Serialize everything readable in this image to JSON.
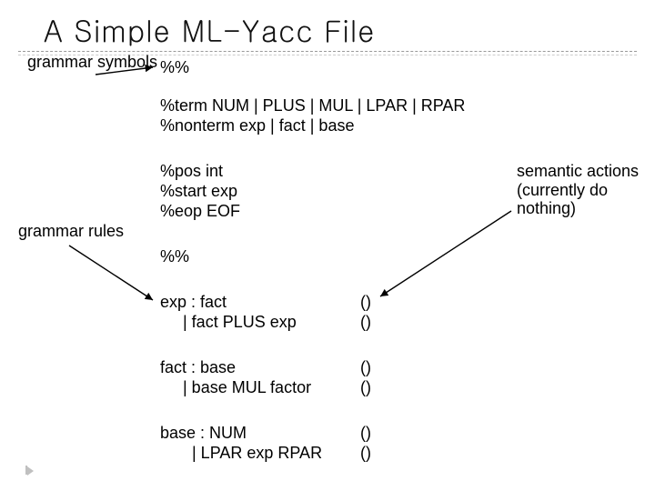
{
  "title": "A Simple ML-Yacc File",
  "annotations": {
    "grammar_symbols": "grammar\nsymbols",
    "grammar_rules": "grammar rules",
    "semantic_actions": "semantic\nactions\n(currently\ndo nothing)"
  },
  "code": {
    "sep1": "%%",
    "term": "%term NUM | PLUS | MUL | LPAR | RPAR",
    "nonterm": "%nonterm exp | fact | base",
    "pos": "%pos int",
    "start": "%start exp",
    "eop": "%eop EOF",
    "sep2": "%%",
    "rule_exp_1": "exp : fact",
    "rule_exp_2": "     | fact PLUS exp",
    "rule_fact_1": "fact : base",
    "rule_fact_2": "     | base MUL factor",
    "rule_base_1": "base : NUM",
    "rule_base_2": "       | LPAR exp RPAR",
    "action1": "()",
    "action2": "()",
    "action3": "()",
    "action4": "()",
    "action5": "()",
    "action6": "()"
  }
}
